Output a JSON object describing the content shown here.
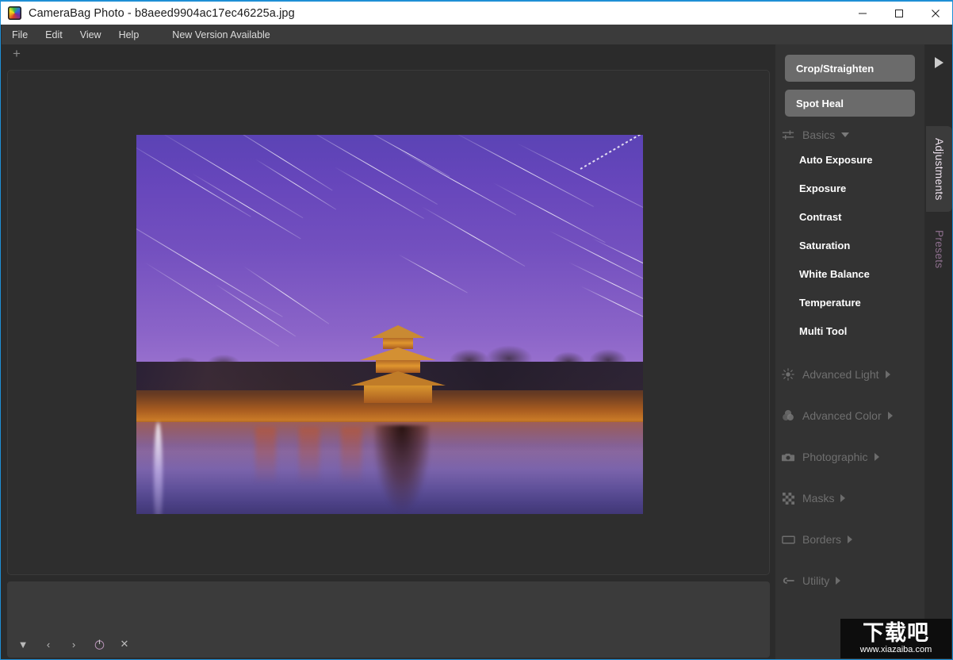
{
  "window": {
    "title": "CameraBag Photo - b8aeed9904ac17ec46225a.jpg",
    "app_name": "CameraBag Photo",
    "file_name": "b8aeed9904ac17ec46225a.jpg",
    "controls": {
      "minimize": "minimize-icon",
      "maximize": "maximize-icon",
      "close": "close-icon"
    },
    "accent": "#1e8fd5"
  },
  "menubar": {
    "items": [
      {
        "label": "File"
      },
      {
        "label": "Edit"
      },
      {
        "label": "View"
      },
      {
        "label": "Help"
      },
      {
        "label": "New Version Available"
      }
    ]
  },
  "tabstrip": {
    "add_label": "+"
  },
  "viewer": {
    "image_alt": "Forbidden City corner tower at dusk with star trails reflected in the moat"
  },
  "filmstrip": {
    "tools": [
      {
        "icon": "triangle-down-icon",
        "glyph": "▼"
      },
      {
        "icon": "chevron-left-icon",
        "glyph": "‹"
      },
      {
        "icon": "chevron-right-icon",
        "glyph": "›"
      },
      {
        "icon": "power-reset-icon",
        "glyph": "⏻"
      },
      {
        "icon": "close-icon",
        "glyph": "✕"
      }
    ]
  },
  "right_panel": {
    "tool_buttons": [
      {
        "label": "Crop/Straighten"
      },
      {
        "label": "Spot Heal"
      }
    ],
    "groups": [
      {
        "label": "Basics",
        "icon": "sliders-icon",
        "expanded": true,
        "items": [
          {
            "label": "Auto Exposure"
          },
          {
            "label": "Exposure"
          },
          {
            "label": "Contrast"
          },
          {
            "label": "Saturation"
          },
          {
            "label": "White Balance"
          },
          {
            "label": "Temperature"
          },
          {
            "label": "Multi Tool"
          }
        ]
      },
      {
        "label": "Advanced Light",
        "icon": "sun-icon",
        "expanded": false,
        "items": []
      },
      {
        "label": "Advanced Color",
        "icon": "color-circles-icon",
        "expanded": false,
        "items": []
      },
      {
        "label": "Photographic",
        "icon": "camera-icon",
        "expanded": false,
        "items": []
      },
      {
        "label": "Masks",
        "icon": "checkerboard-icon",
        "expanded": false,
        "items": []
      },
      {
        "label": "Borders",
        "icon": "rectangle-icon",
        "expanded": false,
        "items": []
      },
      {
        "label": "Utility",
        "icon": "wrench-icon",
        "expanded": false,
        "items": []
      }
    ]
  },
  "side_tabs": {
    "collapse_icon": "triangle-right-icon",
    "tabs": [
      {
        "label": "Adjustments",
        "active": true
      },
      {
        "label": "Presets",
        "active": false
      }
    ]
  },
  "watermark": {
    "text_cn": "下载吧",
    "url": "www.xiazaiba.com"
  },
  "colors": {
    "panel_bg": "#333333",
    "window_bg": "#2b2b2b",
    "menu_bg": "#3b3b3b",
    "button_bg": "#6b6b6b",
    "text_active": "#ffffff",
    "text_dim": "#6f6f6f",
    "accent": "#1e8fd5"
  }
}
